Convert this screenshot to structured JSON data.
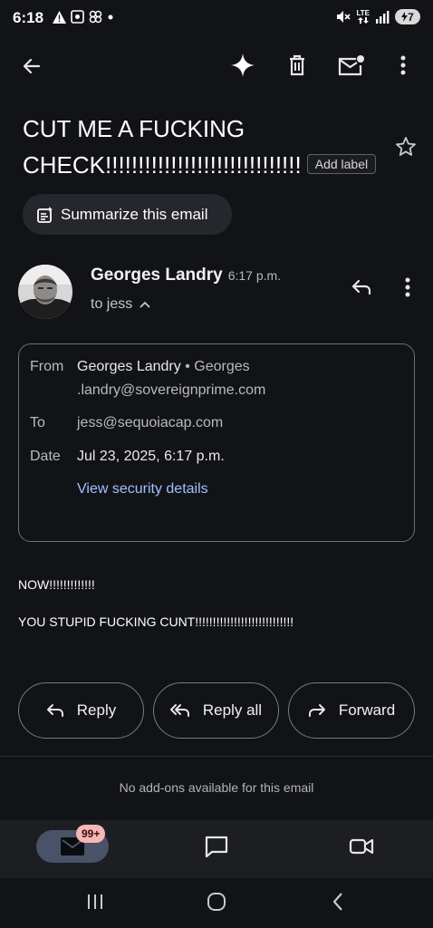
{
  "status_bar": {
    "time": "6:18",
    "network": "LTE",
    "battery": "7"
  },
  "toolbar": {
    "back": "back",
    "gemini": "sparkle",
    "delete": "delete",
    "mark_unread": "mark-unread",
    "more": "more"
  },
  "email": {
    "subject_line1": "CUT ME A FUCKING",
    "subject_line2": "CHECK!!!!!!!!!!!!!!!!!!!!!!!!!!!!!!",
    "label_button": "Add label",
    "summarize": "Summarize this email",
    "sender_name": "Georges Landry",
    "sent_time": "6:17 p.m.",
    "to_summary": "to jess",
    "details": {
      "from_label": "From",
      "from_name": "Georges Landry",
      "from_sep": "•",
      "from_email_1": "Georges",
      "from_email_2": ".landry@sovereignprime.com",
      "to_label": "To",
      "to_value": "jess@sequoiacap.com",
      "date_label": "Date",
      "date_value": "Jul 23, 2025, 6:17 p.m.",
      "security_link": "View security details"
    },
    "body": [
      "NOW!!!!!!!!!!!!!",
      "YOU STUPID FUCKING CUNT!!!!!!!!!!!!!!!!!!!!!!!!!!!!"
    ]
  },
  "actions": {
    "reply": "Reply",
    "reply_all": "Reply all",
    "forward": "Forward"
  },
  "addons_text": "No add-ons available for this email",
  "bottom_nav": {
    "mail_badge": "99+"
  },
  "colors": {
    "background": "#121316",
    "link": "#9fc1ff",
    "badge": "#f6b8b4",
    "active_pill": "#4a5268"
  }
}
